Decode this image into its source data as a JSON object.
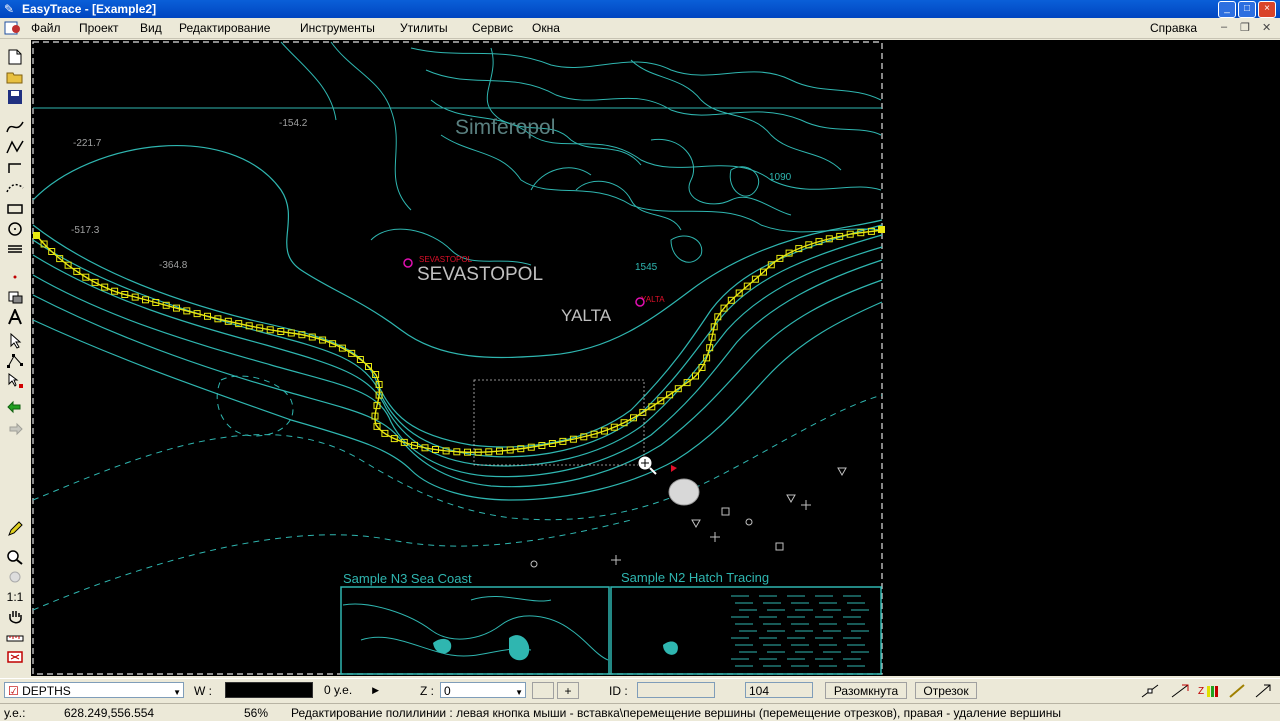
{
  "window": {
    "title": "EasyTrace - [Example2]"
  },
  "menu": {
    "items": [
      "Файл",
      "Проект",
      "Вид",
      "Редактирование",
      "Инструменты",
      "Утилиты",
      "Сервис",
      "Окна"
    ],
    "help": "Справка"
  },
  "map": {
    "city_simferopol": "Simferopol",
    "city_sevastopol": "SEVASTOPOL",
    "city_yalta": "YALTA",
    "small_sevastopol": "SEVASTOPOL",
    "small_yalta": "YALTA",
    "depth_1": "-154.2",
    "depth_2": "-221.7",
    "depth_3": "-517.3",
    "depth_4": "-364.8",
    "elev_1": "1545",
    "elev_2": "1090",
    "sample_n3": "Sample N3  Sea Coast",
    "sample_n2": "Sample N2  Hatch Tracing",
    "colors": {
      "contour": "#2fb6b0",
      "trace": "#e8e810",
      "label": "#9fd0d0",
      "red": "#e0102a"
    }
  },
  "propbar": {
    "layer": "DEPTHS",
    "w_label": "W :",
    "w_units": "0 у.е.",
    "z_label": "Z :",
    "z_value": "0",
    "plus": "+",
    "id_label": "ID :",
    "count": "104",
    "state": "Разомкнута",
    "segment": "Отрезок"
  },
  "status": {
    "units_label": "у.е.:",
    "coords": "628.249,556.554",
    "zoom": "56%",
    "hint": "Редактирование полилинии : левая кнопка мыши - вставка\\перемещение вершины (перемещение отрезков), правая - удаление вершины"
  },
  "toolbar": {
    "icons": [
      "new-icon",
      "open-icon",
      "save-icon",
      "curve-icon",
      "polyline-icon",
      "step-line-icon",
      "dotted-line-icon",
      "rectangle-icon",
      "circle-icon",
      "hatch-icon",
      "point-icon",
      "fill-icon",
      "text-icon",
      "pointer-icon",
      "select-nodes-icon",
      "select-object-icon",
      "undo-icon",
      "redo-icon",
      "pencil-icon",
      "zoom-icon",
      "zoom-all-icon",
      "one-to-one-icon",
      "hand-icon",
      "ruler-icon",
      "fit-icon"
    ],
    "one_to_one": "1:1"
  }
}
